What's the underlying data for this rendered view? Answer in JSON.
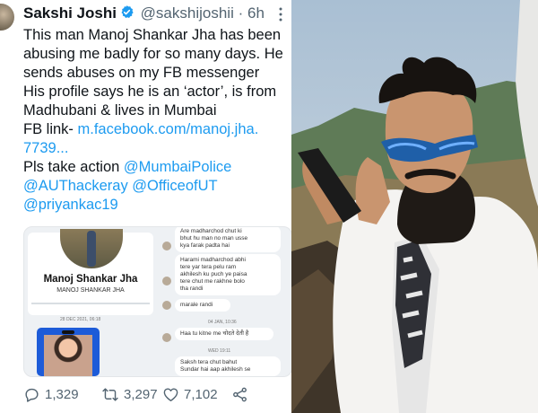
{
  "tweet": {
    "name": "Sakshi Joshi",
    "handle": "@sakshijoshii",
    "dot": "·",
    "time": "6h",
    "lines": [
      "This man Manoj Shankar Jha has been",
      "abusing me badly for so many days. He",
      "sends abuses on my FB messenger",
      "His profile says he is an ‘actor’, is from",
      "Madhubani & lives in Mumbai"
    ],
    "fb_link_label": "FB link-",
    "fb_link": "m.facebook.com/manoj.jha.",
    "fb_link_cont": "7739...",
    "action_label": "Pls take action",
    "mentions": [
      "@MumbaiPolice",
      "@AUThackeray",
      "@OfficeofUT",
      "@priyankac19"
    ]
  },
  "media": {
    "profile_name": "Manoj Shankar Jha",
    "profile_sub": "MANOJ SHANKAR JHA",
    "left_date": "28 DEC 2021, 06:18",
    "messages": [
      "Are madharchod chut ki\nbhut hu man no man usse\nkya farak padta hai",
      "Harami madharchod abhi\ntere yar tera pelu ram\nakhilesh ku puch ye paisa\ntere chut me rakhne bolo\ntha randi",
      "marale randi",
      "Haa tu kitne me चोदते देती है",
      "Saksh tera chut bahut\nSundar hai aap akhilesh se"
    ],
    "dates": [
      "04 JAN, 10:36",
      "WED 19:11"
    ]
  },
  "stats": {
    "replies": "1,329",
    "retweets": "3,297",
    "likes": "7,102"
  },
  "colors": {
    "link": "#1d9bf0",
    "text": "#0f1419",
    "muted": "#536471"
  },
  "icons": [
    "verified-icon",
    "more-icon",
    "reply-icon",
    "retweet-icon",
    "like-icon",
    "share-icon"
  ]
}
